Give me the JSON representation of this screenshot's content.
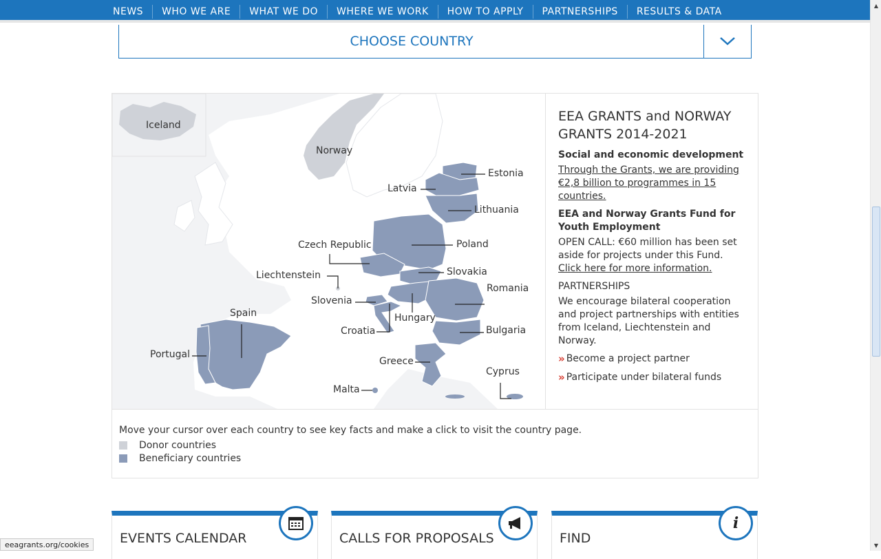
{
  "nav": {
    "items": [
      "NEWS",
      "WHO WE ARE",
      "WHAT WE DO",
      "WHERE WE WORK",
      "HOW TO APPLY",
      "PARTNERSHIPS",
      "RESULTS & DATA"
    ]
  },
  "choose_country": {
    "label": "CHOOSE COUNTRY",
    "icon": "chevron-down-icon"
  },
  "map": {
    "labels": {
      "iceland": "Iceland",
      "norway": "Norway",
      "estonia": "Estonia",
      "latvia": "Latvia",
      "lithuania": "Lithuania",
      "poland": "Poland",
      "czech": "Czech Republic",
      "slovakia": "Slovakia",
      "liechtenstein": "Liechtenstein",
      "romania": "Romania",
      "slovenia": "Slovenia",
      "hungary": "Hungary",
      "spain": "Spain",
      "croatia": "Croatia",
      "bulgaria": "Bulgaria",
      "portugal": "Portugal",
      "greece": "Greece",
      "cyprus": "Cyprus",
      "malta": "Malta"
    },
    "colors": {
      "donor": "#cfd2d8",
      "beneficiary": "#8b9bb8",
      "background": "#f2f3f5",
      "land": "#ffffff"
    }
  },
  "info": {
    "title": "EEA GRANTS and NORWAY GRANTS 2014-2021",
    "section1_heading": "Social and economic development",
    "section1_link": "Through the Grants, we are providing €2,8 billion to programmes in 15 countries.",
    "section2_heading": "EEA and Norway Grants Fund for Youth Employment",
    "section2_text": "OPEN CALL: €60 million has been set aside for projects under this Fund. ",
    "section2_link": "Click here for more information.",
    "section3_heading": "PARTNERSHIPS",
    "section3_text": "We encourage bilateral cooperation and project partnerships with entities from Iceland, Liechtenstein and Norway.",
    "link_partner": "Become a project partner",
    "link_bilateral": "Participate under bilateral funds",
    "arrow": "»"
  },
  "legend": {
    "hint": "Move your cursor over each country to see key facts and make a click to visit the country page.",
    "donor": "Donor countries",
    "beneficiary": "Beneficiary countries"
  },
  "cards": [
    {
      "title": "EVENTS CALENDAR",
      "icon": "calendar-icon"
    },
    {
      "title": "CALLS FOR PROPOSALS",
      "icon": "megaphone-icon"
    },
    {
      "title": "FIND",
      "icon": "info-icon",
      "glyph": "i"
    }
  ],
  "status_bar": {
    "text": "eeagrants.org/cookies"
  },
  "accent": "#1d75bd"
}
